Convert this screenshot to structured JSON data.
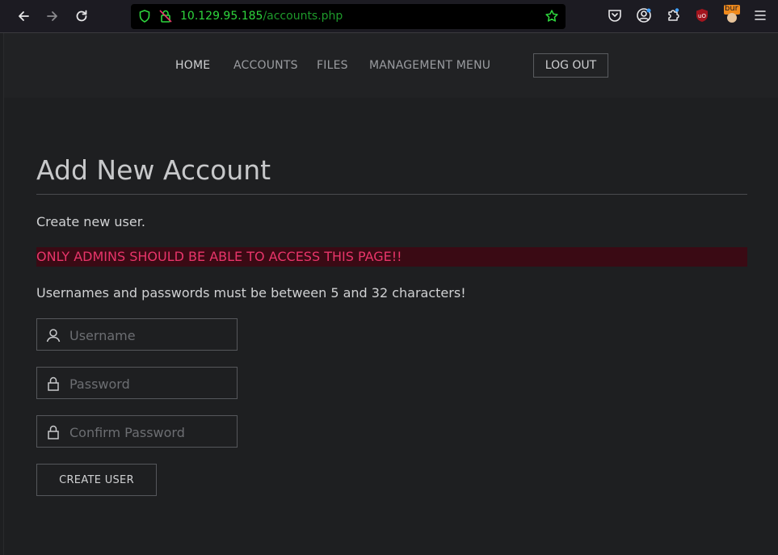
{
  "browser": {
    "url_host": "10.129.95.185",
    "url_path": "/accounts.php",
    "accent": "#2ed63d",
    "ext_badge": "bur"
  },
  "nav": {
    "items": [
      {
        "label": "HOME"
      },
      {
        "label": "ACCOUNTS"
      },
      {
        "label": "FILES"
      },
      {
        "label": "MANAGEMENT MENU"
      }
    ],
    "logout_label": "LOG OUT"
  },
  "main": {
    "title": "Add New Account",
    "subtitle": "Create new user.",
    "warning": "ONLY ADMINS SHOULD BE ABLE TO ACCESS THIS PAGE!!",
    "warning_color": "#e8356a",
    "note": "Usernames and passwords must be between 5 and 32 characters!",
    "fields": {
      "username": {
        "placeholder": "Username",
        "value": "",
        "icon": "user-icon"
      },
      "password": {
        "placeholder": "Password",
        "value": "",
        "icon": "lock-icon"
      },
      "confirm": {
        "placeholder": "Confirm Password",
        "value": "",
        "icon": "lock-icon"
      }
    },
    "submit_label": "CREATE USER"
  }
}
